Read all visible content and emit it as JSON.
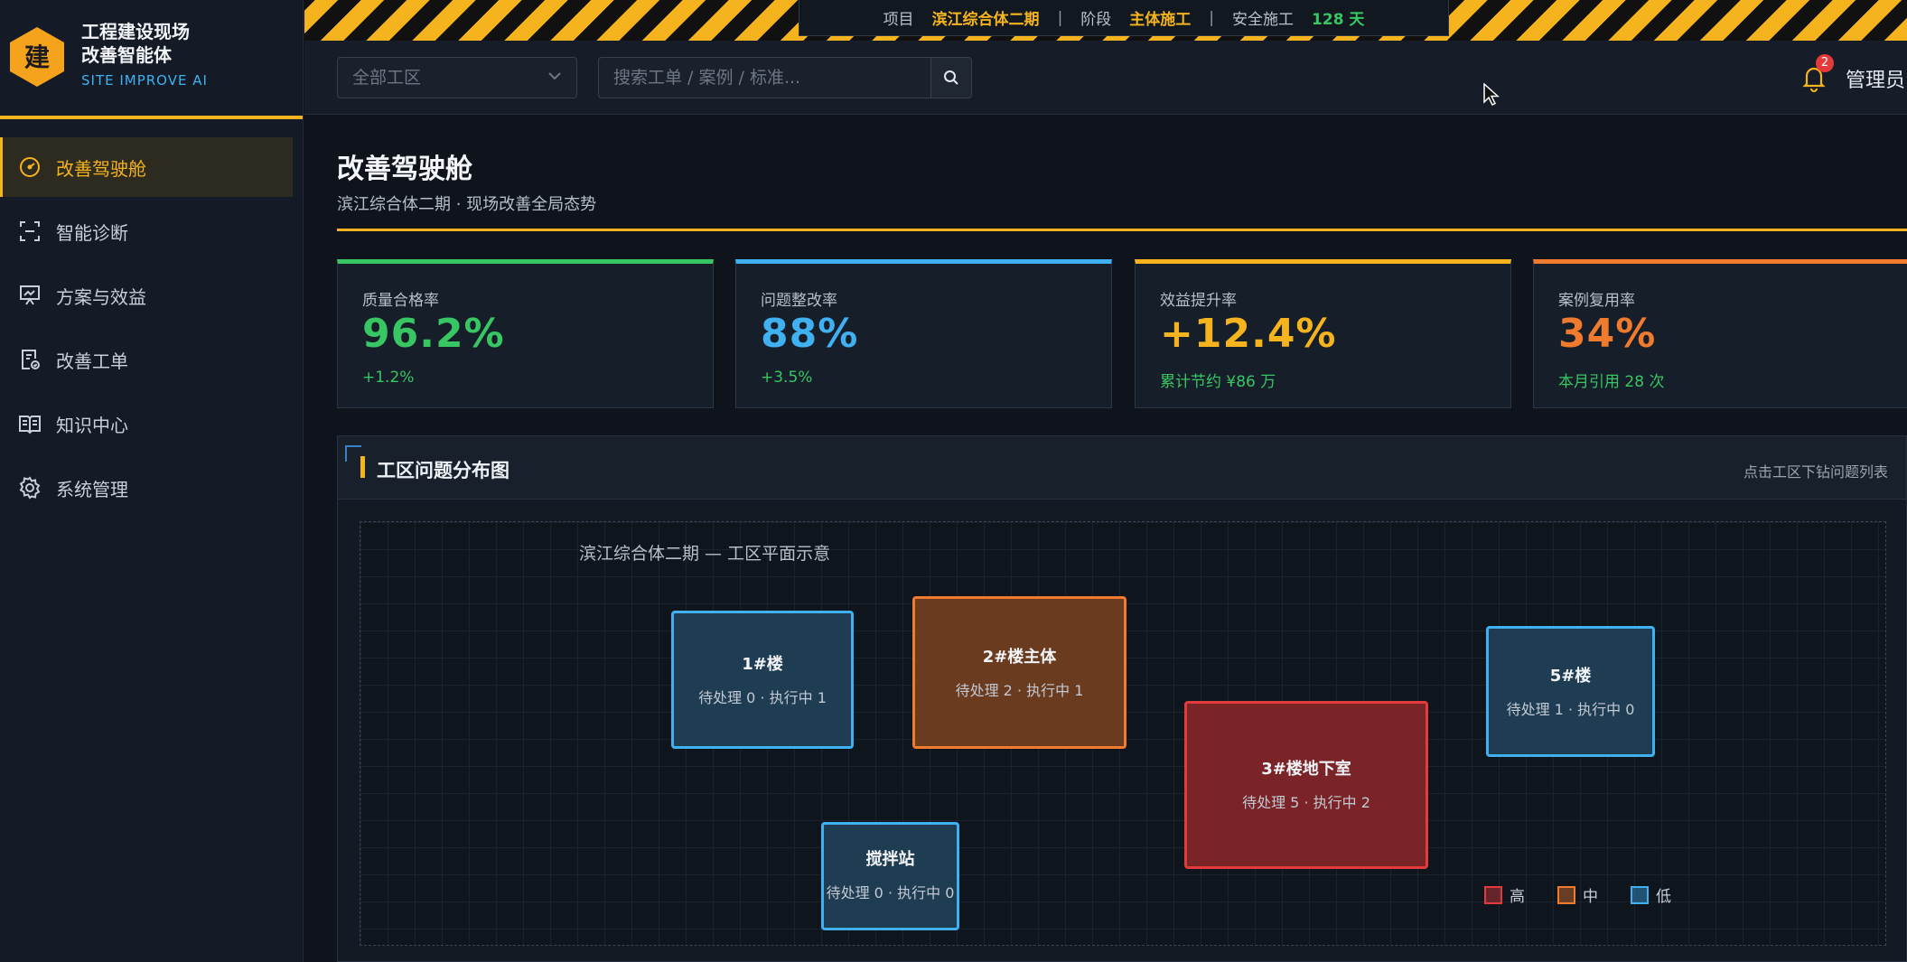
{
  "brand": {
    "logo_char": "建",
    "title_line1": "工程建设现场",
    "title_line2": "改善智能体",
    "subtitle": "SITE IMPROVE AI"
  },
  "nav": {
    "items": [
      {
        "label": "改善驾驶舱",
        "icon": "dashboard-icon",
        "active": true
      },
      {
        "label": "智能诊断",
        "icon": "scan-icon",
        "active": false
      },
      {
        "label": "方案与效益",
        "icon": "presentation-chart-icon",
        "active": false
      },
      {
        "label": "改善工单",
        "icon": "document-check-icon",
        "active": false
      },
      {
        "label": "知识中心",
        "icon": "book-icon",
        "active": false
      },
      {
        "label": "系统管理",
        "icon": "gear-icon",
        "active": false
      }
    ]
  },
  "project_bar": {
    "project_label": "项目",
    "project_value": "滨江综合体二期",
    "stage_label": "阶段",
    "stage_value": "主体施工",
    "safety_label": "安全施工",
    "safety_value": "128 天",
    "separator": "|"
  },
  "toolbar": {
    "zone_select_value": "全部工区",
    "search_placeholder": "搜索工单 / 案例 / 标准...",
    "notification_count": "2",
    "user_name": "管理员"
  },
  "page": {
    "title": "改善驾驶舱",
    "subtitle": "滨江综合体二期 · 现场改善全局态势"
  },
  "kpis": [
    {
      "label": "质量合格率",
      "value": "96.2%",
      "delta": "+1.2%",
      "color": "#38c663"
    },
    {
      "label": "问题整改率",
      "value": "88%",
      "delta": "+3.5%",
      "color": "#3fb0f0"
    },
    {
      "label": "效益提升率",
      "value": "+12.4%",
      "delta": "累计节约 ¥86 万",
      "color": "#f5b41d"
    },
    {
      "label": "案例复用率",
      "value": "34%",
      "delta": "本月引用 28 次",
      "color": "#f07a2e"
    }
  ],
  "panel": {
    "title": "工区问题分布图",
    "hint": "点击工区下钻问题列表",
    "map_title": "滨江综合体二期 — 工区平面示意",
    "zones": [
      {
        "name": "1#楼",
        "stats": "待处理 0 · 执行中 1",
        "level": "low"
      },
      {
        "name": "2#楼主体",
        "stats": "待处理 2 · 执行中 1",
        "level": "mid"
      },
      {
        "name": "3#楼地下室",
        "stats": "待处理 5 · 执行中 2",
        "level": "high"
      },
      {
        "name": "5#楼",
        "stats": "待处理 1 · 执行中 0",
        "level": "low"
      },
      {
        "name": "搅拌站",
        "stats": "待处理 0 · 执行中 0",
        "level": "low"
      }
    ],
    "legend": [
      {
        "label": "高",
        "color": "#e33b3b"
      },
      {
        "label": "中",
        "color": "#f07a2e"
      },
      {
        "label": "低",
        "color": "#3fb0f0"
      }
    ]
  }
}
